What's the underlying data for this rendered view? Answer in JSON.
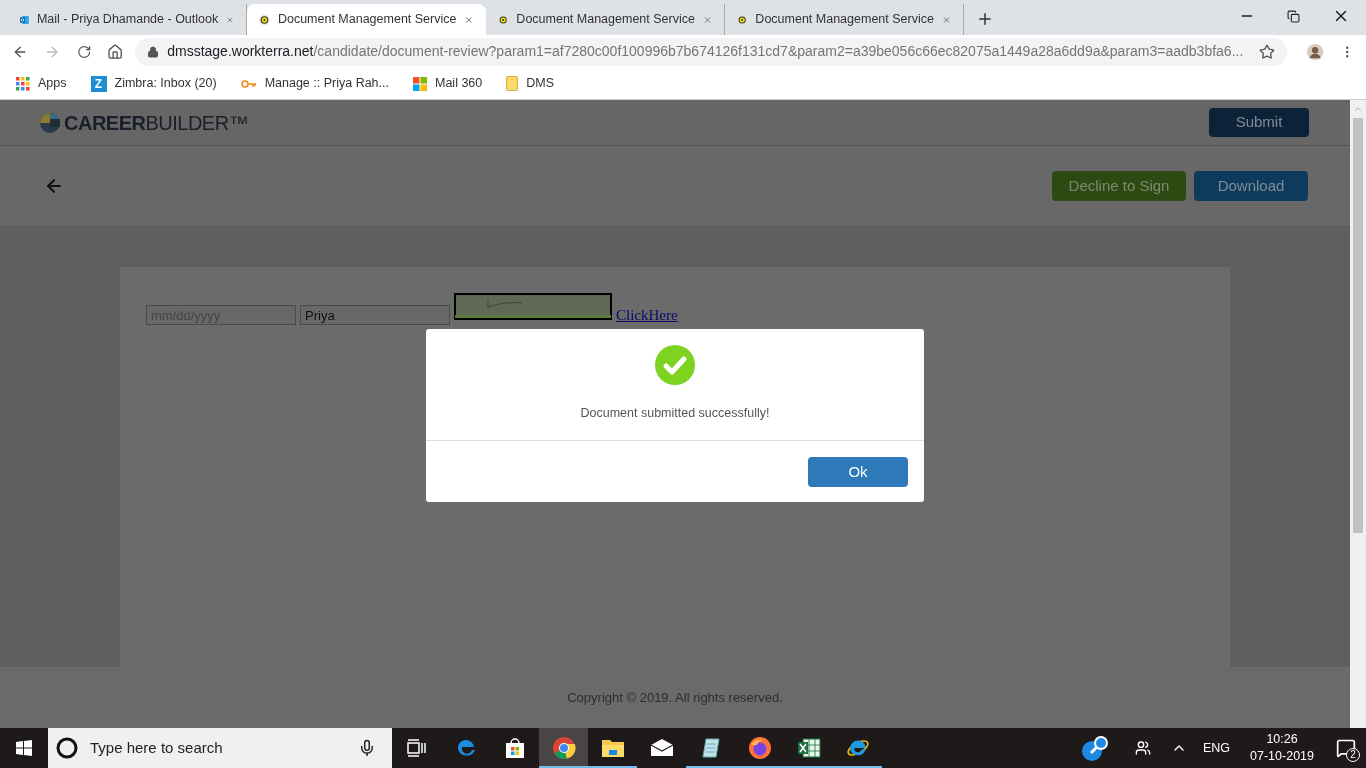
{
  "browser": {
    "tabs": [
      {
        "title": "Mail - Priya Dhamande - Outlook",
        "kind": "outlook",
        "selected": false
      },
      {
        "title": "Document Management Service",
        "kind": "dms",
        "selected": true
      },
      {
        "title": "Document Management Service",
        "kind": "dms",
        "selected": false
      },
      {
        "title": "Document Management Service",
        "kind": "dms",
        "selected": false
      }
    ],
    "url": {
      "host": "dmsstage.workterra.net",
      "path": "/candidate/document-review?param1=af7280c00f100996b7b674126f131cd7&param2=a39be056c66ec82075a1449a28a6dd9a&param3=aadb3bfa6..."
    },
    "bookmarks": [
      {
        "label": "Apps",
        "kind": "apps"
      },
      {
        "label": "Zimbra: Inbox (20)",
        "kind": "zimbra",
        "icon_letter": "Z"
      },
      {
        "label": "Manage :: Priya Rah...",
        "kind": "key"
      },
      {
        "label": "Mail 360",
        "kind": "windows"
      },
      {
        "label": "DMS",
        "kind": "folder"
      }
    ]
  },
  "page": {
    "logo": "**CAREER**BUILDER™",
    "submit": "Submit",
    "decline": "Decline to Sign",
    "download": "Download",
    "document": {
      "date_field": {
        "placeholder": "mm/dd/yyyy"
      },
      "name_field": {
        "value": "Priya"
      },
      "link": "ClickHere"
    },
    "footer": "Copyright © 2019. All rights reserved."
  },
  "dialog": {
    "message": "Document submitted successfully!",
    "ok": "Ok"
  },
  "taskbar": {
    "search_placeholder": "Type here to search",
    "apps": [
      {
        "kind": "taskview",
        "open": false,
        "selected": false
      },
      {
        "kind": "edge",
        "open": false,
        "selected": false
      },
      {
        "kind": "store",
        "open": false,
        "selected": false
      },
      {
        "kind": "chrome",
        "open": true,
        "selected": true
      },
      {
        "kind": "explorer",
        "open": true,
        "selected": false
      },
      {
        "kind": "mail",
        "open": false,
        "selected": false
      },
      {
        "kind": "notepad",
        "open": true,
        "selected": false
      },
      {
        "kind": "firefox",
        "open": true,
        "selected": false
      },
      {
        "kind": "excel",
        "open": true,
        "selected": false
      },
      {
        "kind": "ie",
        "open": true,
        "selected": false
      }
    ],
    "language": "ENG",
    "time": "10:26",
    "date": "07-10-2019",
    "notifications": "2"
  }
}
